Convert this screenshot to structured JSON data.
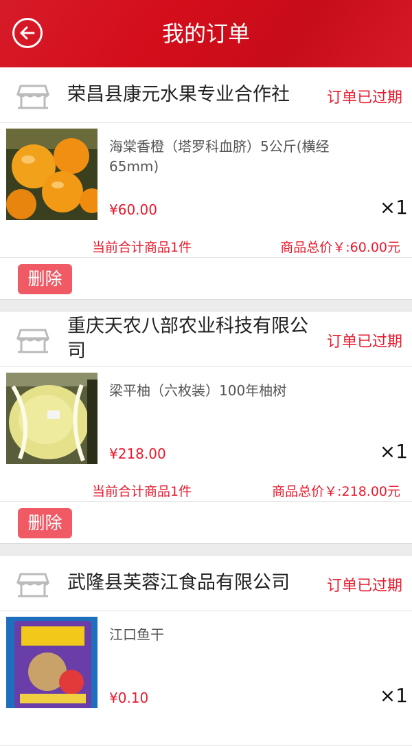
{
  "header": {
    "title": "我的订单",
    "back_icon": "back-arrow-icon"
  },
  "colors": {
    "brand": "#d40d1b",
    "accent": "#e8192c",
    "delete": "#f05a64"
  },
  "orders": [
    {
      "shop": "荣昌县康元水果专业合作社",
      "status": "订单已过期",
      "product_name": "海棠香橙（塔罗科血脐）5公斤(横经65mm)",
      "price": "¥60.00",
      "qty": "×1",
      "count_text": "当前合计商品1件",
      "total_text": "商品总价￥:60.00元",
      "delete_label": "删除"
    },
    {
      "shop": "重庆天农八部农业科技有限公司",
      "status": "订单已过期",
      "product_name": "梁平柚（六枚装）100年柚树",
      "price": "¥218.00",
      "qty": "×1",
      "count_text": "当前合计商品1件",
      "total_text": "商品总价￥:218.00元",
      "delete_label": "删除"
    },
    {
      "shop": "武隆县芙蓉江食品有限公司",
      "status": "订单已过期",
      "product_name": "江口鱼干",
      "price": "¥0.10",
      "qty": "×1"
    }
  ]
}
